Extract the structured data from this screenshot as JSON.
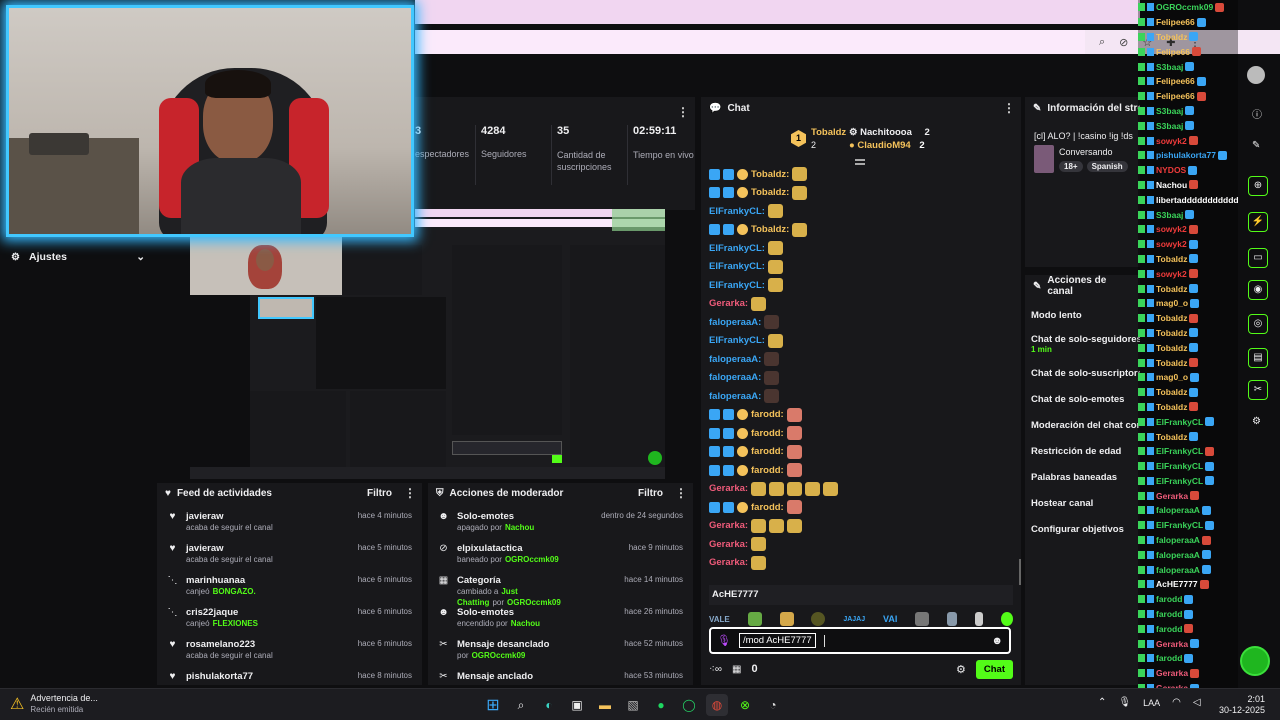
{
  "stats": {
    "viewers_label": "espectadores",
    "followers": {
      "value": "4284",
      "label": "Seguidores"
    },
    "subs": {
      "value": "35",
      "label": "Cantidad de suscripciones"
    },
    "uptime": {
      "value": "02:59:11",
      "label": "Tiempo en vivo"
    },
    "viewers_value": "3"
  },
  "settings": {
    "label": "Ajustes"
  },
  "chat": {
    "title": "Chat",
    "top_users": [
      {
        "rank": "1",
        "name": "Tobaldz",
        "count": "2"
      },
      {
        "name": "Nachitoooa",
        "count": "2"
      },
      {
        "name": "ClaudioM94",
        "count": "2"
      }
    ],
    "messages": [
      {
        "user": "Tobaldz:",
        "color": "#f4c25b"
      },
      {
        "user": "Tobaldz:",
        "color": "#f4c25b"
      },
      {
        "user": "ElFrankyCL:",
        "color": "#3aa6f5"
      },
      {
        "user": "Tobaldz:",
        "color": "#f4c25b"
      },
      {
        "user": "ElFrankyCL:",
        "color": "#3aa6f5"
      },
      {
        "user": "ElFrankyCL:",
        "color": "#3aa6f5"
      },
      {
        "user": "ElFrankyCL:",
        "color": "#3aa6f5"
      },
      {
        "user": "Gerarka:",
        "color": "#ef5b7a"
      },
      {
        "user": "faloperaaA:",
        "color": "#3aa6f5"
      },
      {
        "user": "ElFrankyCL:",
        "color": "#3aa6f5"
      },
      {
        "user": "faloperaaA:",
        "color": "#3aa6f5"
      },
      {
        "user": "faloperaaA:",
        "color": "#3aa6f5"
      },
      {
        "user": "faloperaaA:",
        "color": "#3aa6f5"
      },
      {
        "user": "farodd:",
        "color": "#f4c25b"
      },
      {
        "user": "farodd:",
        "color": "#f4c25b"
      },
      {
        "user": "farodd:",
        "color": "#f4c25b"
      },
      {
        "user": "farodd:",
        "color": "#f4c25b"
      },
      {
        "user": "Gerarka:",
        "color": "#ef5b7a"
      },
      {
        "user": "farodd:",
        "color": "#f4c25b"
      },
      {
        "user": "Gerarka:",
        "color": "#ef5b7a"
      },
      {
        "user": "Gerarka:",
        "color": "#ef5b7a"
      },
      {
        "user": "Gerarka:",
        "color": "#ef5b7a"
      }
    ],
    "mention_user": "AcHE7777",
    "emote_bar": [
      "VALE",
      "JAJAJ",
      "VAI"
    ],
    "input_value": "/mod AcHE7777",
    "points": "0",
    "send_label": "Chat"
  },
  "stream_info": {
    "title": "Información del stream",
    "stream_title": "[cl] ALO? | !casino !ig !ds",
    "category": "Conversando",
    "tags": [
      "18+",
      "Spanish"
    ]
  },
  "channel_actions": {
    "title": "Acciones de canal",
    "items": [
      {
        "label": "Modo lento",
        "sub": ""
      },
      {
        "label": "Chat de solo-seguidores",
        "sub": "1 min"
      },
      {
        "label": "Chat de solo-suscriptores",
        "sub": ""
      },
      {
        "label": "Chat de solo-emotes",
        "sub": ""
      },
      {
        "label": "Moderación del chat con IA",
        "sub": ""
      },
      {
        "label": "Restricción de edad",
        "sub": ""
      },
      {
        "label": "Palabras baneadas",
        "sub": ""
      },
      {
        "label": "Hostear canal",
        "sub": ""
      },
      {
        "label": "Configurar objetivos",
        "sub": ""
      }
    ]
  },
  "activity_feed": {
    "title": "Feed de actividades",
    "filter": "Filtro",
    "items": [
      {
        "user": "javieraw",
        "desc": "acaba de seguir el canal",
        "time": "hace 4 minutos"
      },
      {
        "user": "javieraw",
        "desc": "acaba de seguir el canal",
        "time": "hace 5 minutos"
      },
      {
        "user": "marinhuanaa",
        "desc": "canjeó",
        "reward": "BONGAZO.",
        "time": "hace 6 minutos"
      },
      {
        "user": "cris22jaque",
        "desc": "canjeó",
        "reward": "FLEXIONES",
        "time": "hace 6 minutos"
      },
      {
        "user": "rosamelano223",
        "desc": "acaba de seguir el canal",
        "time": "hace 6 minutos"
      },
      {
        "user": "pishulakorta77",
        "desc": "",
        "time": "hace 8 minutos"
      }
    ]
  },
  "mod_actions": {
    "title": "Acciones de moderador",
    "filter": "Filtro",
    "items": [
      {
        "action": "Solo-emotes",
        "pre": "apagado por",
        "by": "Nachou",
        "time": "dentro de 24 segundos"
      },
      {
        "action": "elpixulatactica",
        "pre": "baneado por",
        "by": "OGROccmk09",
        "time": "hace 9 minutos"
      },
      {
        "action": "Categoría",
        "pre": "cambiado a",
        "mid": "Just Chatting",
        "pre2": "por",
        "by": "OGROccmk09",
        "time": "hace 14 minutos"
      },
      {
        "action": "Solo-emotes",
        "pre": "encendido por",
        "by": "Nachou",
        "time": "hace 26 minutos"
      },
      {
        "action": "Mensaje desanclado",
        "pre": "por",
        "by": "OGROccmk09",
        "time": "hace 52 minutos"
      },
      {
        "action": "Mensaje anclado",
        "pre": "",
        "by": "",
        "time": "hace 53 minutos"
      }
    ]
  },
  "overlay_chat": [
    {
      "user": "OGROccmk09",
      "color": "#3ad45a"
    },
    {
      "user": "Felipee66",
      "color": "#f4c25b"
    },
    {
      "user": "Tobaldz",
      "color": "#f4c25b"
    },
    {
      "user": "Felipe66",
      "color": "#f4c25b"
    },
    {
      "user": "S3baaj",
      "color": "#3ad45a"
    },
    {
      "user": "Felipee66",
      "color": "#f4c25b"
    },
    {
      "user": "Felipee66",
      "color": "#f4c25b"
    },
    {
      "user": "S3baaj",
      "color": "#3ad45a"
    },
    {
      "user": "S3baaj",
      "color": "#3ad45a"
    },
    {
      "user": "sowyk2",
      "color": "#ef3b3b"
    },
    {
      "user": "pishulakorta77",
      "color": "#3aa6f5"
    },
    {
      "user": "NYDOS",
      "color": "#ef3b3b"
    },
    {
      "user": "Nachou",
      "color": "#ffffff"
    },
    {
      "user": "libertaddddddddddddd",
      "color": "#ffffff"
    },
    {
      "user": "S3baaj",
      "color": "#3ad45a"
    },
    {
      "user": "sowyk2",
      "color": "#ef3b3b"
    },
    {
      "user": "sowyk2",
      "color": "#ef3b3b"
    },
    {
      "user": "Tobaldz",
      "color": "#f4c25b"
    },
    {
      "user": "sowyk2",
      "color": "#ef3b3b"
    },
    {
      "user": "Tobaldz",
      "color": "#f4c25b"
    },
    {
      "user": "mag0_o",
      "color": "#f4c25b"
    },
    {
      "user": "Tobaldz",
      "color": "#f4c25b"
    },
    {
      "user": "Tobaldz",
      "color": "#f4c25b"
    },
    {
      "user": "Tobaldz",
      "color": "#f4c25b"
    },
    {
      "user": "Tobaldz",
      "color": "#f4c25b"
    },
    {
      "user": "mag0_o",
      "color": "#f4c25b"
    },
    {
      "user": "Tobaldz",
      "color": "#f4c25b"
    },
    {
      "user": "Tobaldz",
      "color": "#f4c25b"
    },
    {
      "user": "ElFrankyCL",
      "color": "#3ad45a"
    },
    {
      "user": "Tobaldz",
      "color": "#f4c25b"
    },
    {
      "user": "ElFrankyCL",
      "color": "#3ad45a"
    },
    {
      "user": "ElFrankyCL",
      "color": "#3ad45a"
    },
    {
      "user": "ElFrankyCL",
      "color": "#3ad45a"
    },
    {
      "user": "Gerarka",
      "color": "#ef5b7a"
    },
    {
      "user": "faloperaaA",
      "color": "#3ad45a"
    },
    {
      "user": "ElFrankyCL",
      "color": "#3ad45a"
    },
    {
      "user": "faloperaaA",
      "color": "#3ad45a"
    },
    {
      "user": "faloperaaA",
      "color": "#3ad45a"
    },
    {
      "user": "faloperaaA",
      "color": "#3ad45a"
    },
    {
      "user": "AcHE7777",
      "color": "#ffffff"
    },
    {
      "user": "farodd",
      "color": "#3ad45a"
    },
    {
      "user": "farodd",
      "color": "#3ad45a"
    },
    {
      "user": "farodd",
      "color": "#3ad45a"
    },
    {
      "user": "Gerarka",
      "color": "#ef5b7a"
    },
    {
      "user": "farodd",
      "color": "#3ad45a"
    },
    {
      "user": "Gerarka",
      "color": "#ef5b7a"
    },
    {
      "user": "Gerarka",
      "color": "#ef5b7a"
    }
  ],
  "notification": {
    "title": "Advertencia de...",
    "sub": "Recién emitida"
  },
  "taskbar": {
    "lang": "LAA",
    "time": "2:01",
    "date": "30-12-2025"
  },
  "colors": {
    "accent": "#53fc18",
    "panel": "#18181b",
    "bg": "#0e0e10",
    "webcam_glow": "#42c8ff"
  }
}
